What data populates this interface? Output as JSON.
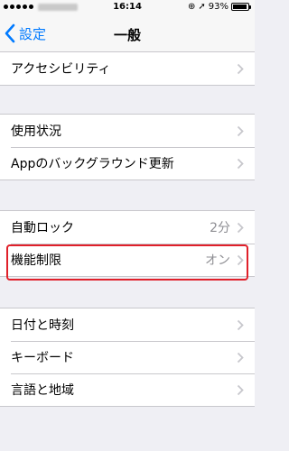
{
  "status": {
    "time": "16:14",
    "battery": "93%",
    "battery_level": 0.93
  },
  "nav": {
    "back_label": "設定",
    "title": "一般"
  },
  "groups": [
    [
      {
        "label": "アクセシビリティ",
        "value": ""
      }
    ],
    [
      {
        "label": "使用状況",
        "value": ""
      },
      {
        "label": "Appのバックグラウンド更新",
        "value": ""
      }
    ],
    [
      {
        "label": "自動ロック",
        "value": "2分"
      },
      {
        "label": "機能制限",
        "value": "オン"
      }
    ],
    [
      {
        "label": "日付と時刻",
        "value": ""
      },
      {
        "label": "キーボード",
        "value": ""
      },
      {
        "label": "言語と地域",
        "value": ""
      }
    ]
  ],
  "colors": {
    "accent": "#007aff",
    "highlight": "#e0202a",
    "background": "#efeff4"
  }
}
